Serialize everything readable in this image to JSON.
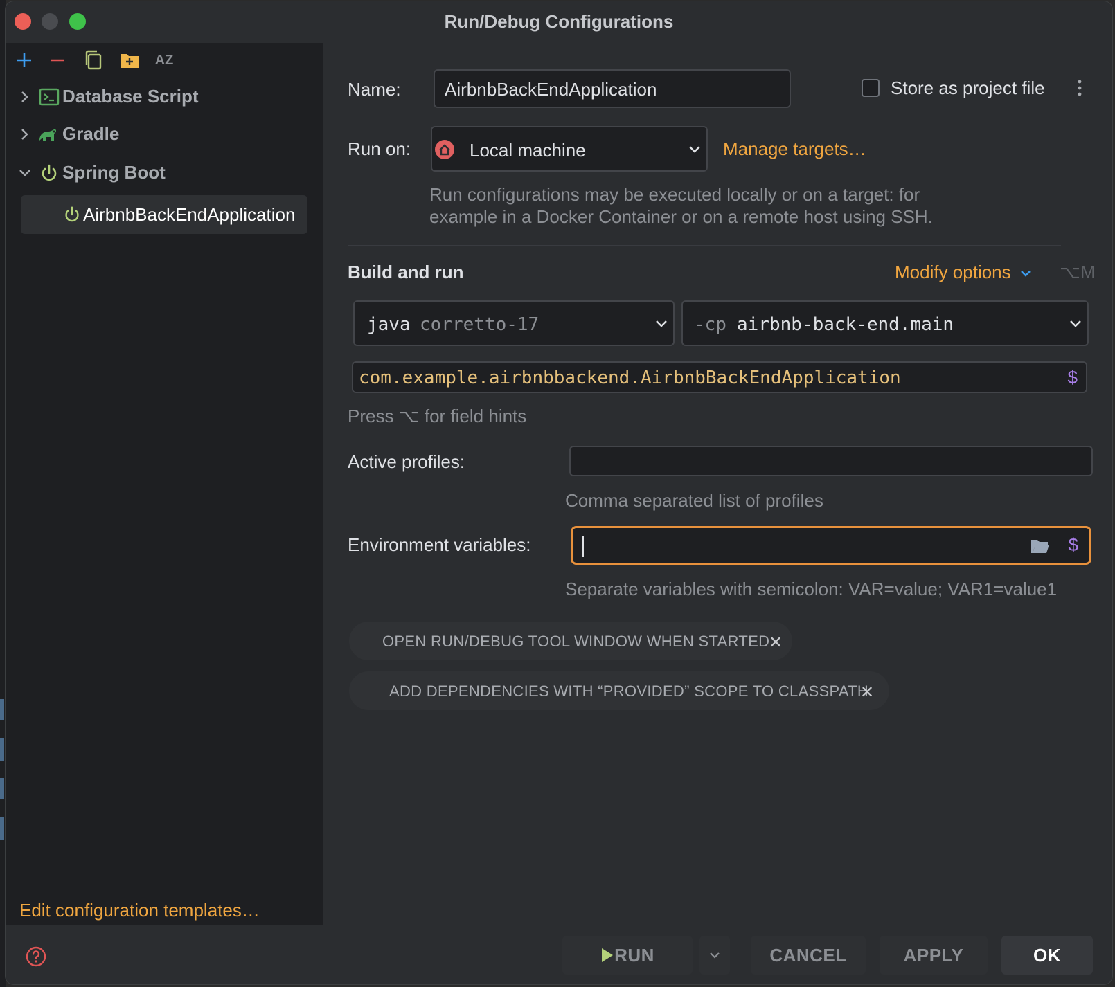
{
  "window": {
    "title": "Run/Debug Configurations"
  },
  "sidebar": {
    "toolbar": {
      "add_icon": "plus-icon",
      "remove_icon": "minus-icon",
      "copy_icon": "copy-icon",
      "folder_icon": "new-folder-icon",
      "sort_icon": "sort-az-icon",
      "sort_label": "AZ"
    },
    "tree": [
      {
        "label": "Database Script",
        "icon": "database-script-icon",
        "expanded": false
      },
      {
        "label": "Gradle",
        "icon": "gradle-elephant-icon",
        "expanded": false
      },
      {
        "label": "Spring Boot",
        "icon": "spring-boot-power-icon",
        "expanded": true
      },
      {
        "label": "AirbnbBackEndApplication",
        "icon": "spring-boot-power-icon",
        "selected": true
      }
    ],
    "edit_templates_link": "Edit configuration templates…"
  },
  "form": {
    "name_label": "Name:",
    "name_value": "AirbnbBackEndApplication",
    "store_label": "Store as project file",
    "store_checked": false,
    "run_on_label": "Run on:",
    "run_on_value": "Local machine",
    "manage_targets": "Manage targets…",
    "run_on_help_line1": "Run configurations may be executed locally or on a target: for",
    "run_on_help_line2": "example in a Docker Container or on a remote host using SSH.",
    "build_run_title": "Build and run",
    "modify_options": "Modify options",
    "modify_shortcut": "⌥M",
    "jdk_keyword": "java",
    "jdk_value": "corretto-17",
    "cp_keyword": "-cp",
    "cp_value": "airbnb-back-end.main",
    "main_class": "com.example.airbnbbackend.AirbnbBackEndApplication",
    "field_hints": "Press ⌥ for field hints",
    "active_profiles_label": "Active profiles:",
    "active_profiles_value": "",
    "active_profiles_hint": "Comma separated list of profiles",
    "env_vars_label": "Environment variables:",
    "env_vars_value": "",
    "env_vars_hint": "Separate variables with semicolon: VAR=value; VAR1=value1",
    "chips": [
      "OPEN RUN/DEBUG TOOL WINDOW WHEN STARTED",
      "ADD DEPENDENCIES WITH “PROVIDED” SCOPE TO CLASSPATH"
    ]
  },
  "buttons": {
    "run": "RUN",
    "cancel": "CANCEL",
    "apply": "APPLY",
    "ok": "OK"
  },
  "colors": {
    "accent_orange": "#f0a640",
    "focus_orange": "#e8913c",
    "main_class_yellow": "#e5c07b",
    "dollar_purple": "#a87ee8",
    "spring_green": "#b4d27a"
  }
}
